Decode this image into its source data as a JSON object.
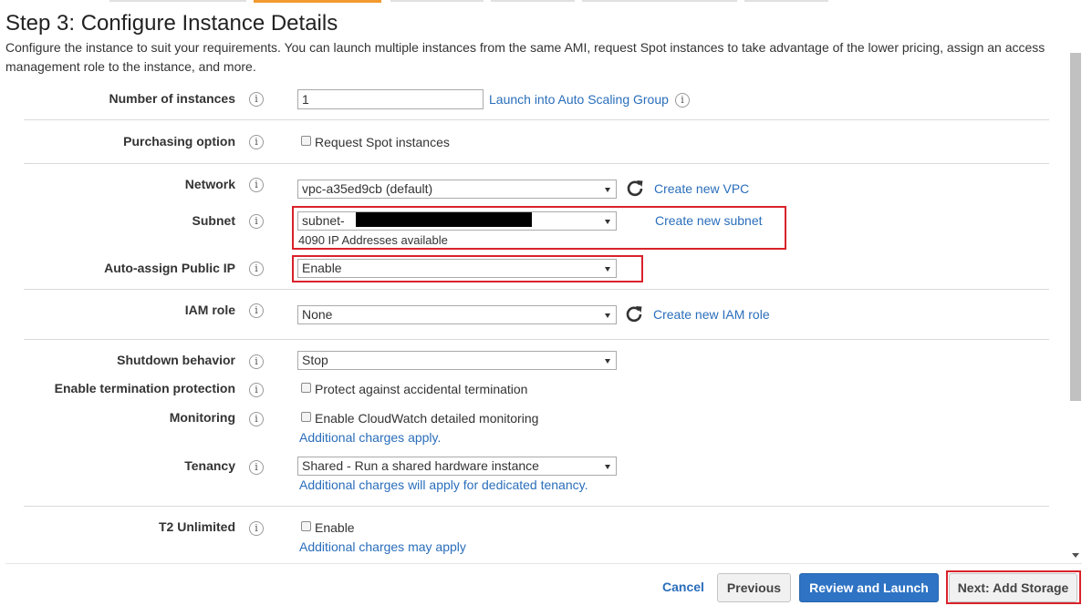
{
  "header": {
    "title": "Step 3: Configure Instance Details",
    "description": "Configure the instance to suit your requirements. You can launch multiple instances from the same AMI, request Spot instances to take advantage of the lower pricing, assign an access management role to the instance, and more."
  },
  "info_icon_glyph": "i",
  "rows": {
    "instances": {
      "label": "Number of instances",
      "value": "1",
      "link": "Launch into Auto Scaling Group"
    },
    "purchasing": {
      "label": "Purchasing option",
      "checkbox_label": "Request Spot instances"
    },
    "network": {
      "label": "Network",
      "value": "vpc-a35ed9cb (default)",
      "link": "Create new VPC"
    },
    "subnet": {
      "label": "Subnet",
      "value": "subnet-",
      "available": "4090 IP Addresses available",
      "link": "Create new subnet"
    },
    "public_ip": {
      "label": "Auto-assign Public IP",
      "value": "Enable"
    },
    "iam": {
      "label": "IAM role",
      "value": "None",
      "link": "Create new IAM role"
    },
    "shutdown": {
      "label": "Shutdown behavior",
      "value": "Stop"
    },
    "termination": {
      "label": "Enable termination protection",
      "checkbox_label": "Protect against accidental termination"
    },
    "monitoring": {
      "label": "Monitoring",
      "checkbox_label": "Enable CloudWatch detailed monitoring",
      "note": "Additional charges apply."
    },
    "tenancy": {
      "label": "Tenancy",
      "value": "Shared - Run a shared hardware instance",
      "note": "Additional charges will apply for dedicated tenancy."
    },
    "t2": {
      "label": "T2 Unlimited",
      "checkbox_label": "Enable",
      "note": "Additional charges may apply"
    }
  },
  "footer": {
    "cancel": "Cancel",
    "previous": "Previous",
    "review": "Review and Launch",
    "next": "Next: Add Storage"
  },
  "colors": {
    "link": "#2a6ebb",
    "highlight": "#d9222a",
    "primary": "#2e73c4",
    "active_tab": "#f29a2e"
  }
}
